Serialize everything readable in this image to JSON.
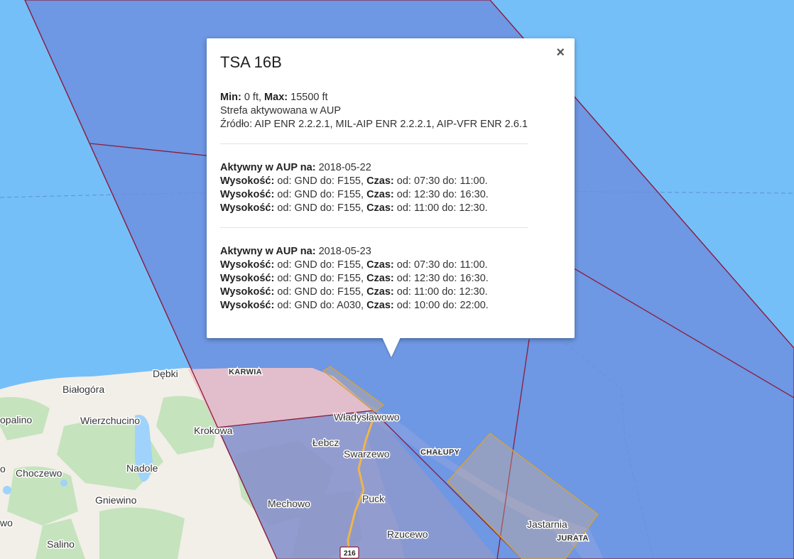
{
  "map": {
    "places": [
      {
        "id": "karwia",
        "label": "KARWIA",
        "style": "bold"
      },
      {
        "id": "debki",
        "label": "Dębki",
        "style": "normal"
      },
      {
        "id": "bialogora",
        "label": "Białogóra",
        "style": "normal"
      },
      {
        "id": "opalino",
        "label": "opalino",
        "style": "normal"
      },
      {
        "id": "wierzchucino",
        "label": "Wierzchucino",
        "style": "normal"
      },
      {
        "id": "krokowa",
        "label": "Krokowa",
        "style": "normal"
      },
      {
        "id": "wladyslawowo",
        "label": "Władysławowo",
        "style": "normal"
      },
      {
        "id": "lebcz",
        "label": "Łebcz",
        "style": "normal"
      },
      {
        "id": "swarzewo",
        "label": "Swarzewo",
        "style": "normal"
      },
      {
        "id": "chalupy",
        "label": "CHAŁUPY",
        "style": "bold"
      },
      {
        "id": "choczewo",
        "label": "Choczewo",
        "style": "normal"
      },
      {
        "id": "nadole",
        "label": "Nadole",
        "style": "normal"
      },
      {
        "id": "gniewino",
        "label": "Gniewino",
        "style": "normal"
      },
      {
        "id": "mechowo",
        "label": "Mechowo",
        "style": "normal"
      },
      {
        "id": "puck",
        "label": "Puck",
        "style": "normal"
      },
      {
        "id": "rzucewo",
        "label": "Rzucewo",
        "style": "normal"
      },
      {
        "id": "jastarnia",
        "label": "Jastarnia",
        "style": "normal"
      },
      {
        "id": "jurata",
        "label": "JURATA",
        "style": "bold"
      },
      {
        "id": "salino",
        "label": "Salino",
        "style": "normal"
      },
      {
        "id": "owo",
        "label": "o",
        "style": "normal"
      },
      {
        "id": "wo",
        "label": "wo",
        "style": "normal"
      }
    ],
    "road_label": "216",
    "colors": {
      "sea": "#75bff9",
      "zone_fill": "#6d8fe0",
      "zone_border": "#8b1c3a",
      "land": "#f1efe8",
      "land_green": "#c8e6c0",
      "restricted_fill": "#f3c3c8",
      "orange_border": "#d4a236"
    }
  },
  "popup": {
    "title": "TSA 16B",
    "close": "×",
    "info": {
      "min_label": "Min:",
      "min_value": "0 ft,",
      "max_label": "Max:",
      "max_value": "15500 ft",
      "status": "Strefa aktywowana w AUP",
      "source": "Źródło: AIP ENR 2.2.2.1, MIL-AIP ENR 2.2.2.1, AIP-VFR ENR 2.6.1"
    },
    "days": [
      {
        "active_label": "Aktywny w AUP na:",
        "date": "2018-05-22",
        "rows": [
          {
            "height_label": "Wysokość:",
            "height": "od: GND do: F155,",
            "time_label": "Czas:",
            "time": "od: 07:30 do: 11:00."
          },
          {
            "height_label": "Wysokość:",
            "height": "od: GND do: F155,",
            "time_label": "Czas:",
            "time": "od: 12:30 do: 16:30."
          },
          {
            "height_label": "Wysokość:",
            "height": "od: GND do: F155,",
            "time_label": "Czas:",
            "time": "od: 11:00 do: 12:30."
          }
        ]
      },
      {
        "active_label": "Aktywny w AUP na:",
        "date": "2018-05-23",
        "rows": [
          {
            "height_label": "Wysokość:",
            "height": "od: GND do: F155,",
            "time_label": "Czas:",
            "time": "od: 07:30 do: 11:00."
          },
          {
            "height_label": "Wysokość:",
            "height": "od: GND do: F155,",
            "time_label": "Czas:",
            "time": "od: 12:30 do: 16:30."
          },
          {
            "height_label": "Wysokość:",
            "height": "od: GND do: F155,",
            "time_label": "Czas:",
            "time": "od: 11:00 do: 12:30."
          },
          {
            "height_label": "Wysokość:",
            "height": "od: GND do: A030,",
            "time_label": "Czas:",
            "time": "od: 10:00 do: 22:00."
          }
        ]
      }
    ]
  }
}
